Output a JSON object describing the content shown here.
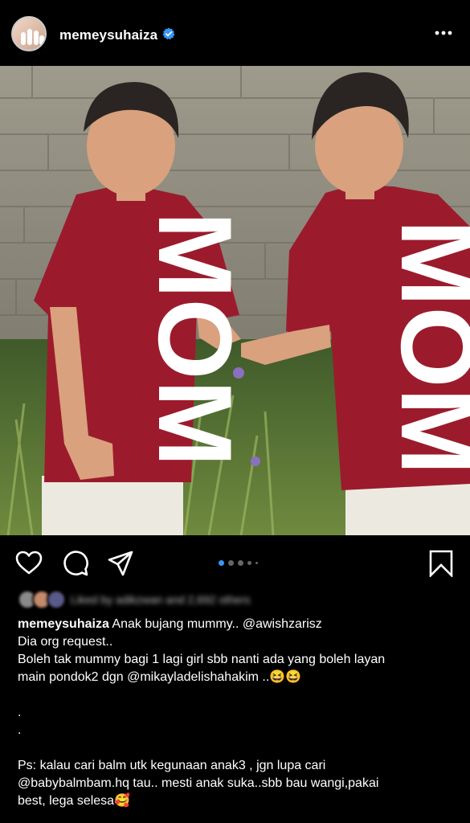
{
  "post": {
    "username": "memeysuhaiza",
    "likes_text": "Liked by adikzwan and 2,692 others",
    "carousel": {
      "count": 5,
      "active_index": 0
    },
    "caption": {
      "line1_text": "Anak bujang mummy..",
      "line1_mention": "@awishzarisz",
      "line2": "Dia org request..",
      "line3": "Boleh tak mummy bagi  1 lagi girl sbb nanti ada yang boleh layan",
      "line4_text": "main pondok2 dgn",
      "line4_mention": "@mikayladelishahakim",
      "line4_tail": "..😆😆",
      "dot1": ".",
      "dot2": ".",
      "line5": "Ps: kalau cari balm utk kegunaan anak3 , jgn lupa cari",
      "line6": "@babybalmbam.hq tau.. mesti anak suka..sbb bau wangi,pakai",
      "line7": "best, lega selesa🥰"
    },
    "photo": {
      "shirt_text": "MOM"
    }
  },
  "icons": {
    "more": "more-horizontal-icon",
    "like": "heart-icon",
    "comment": "comment-icon",
    "share": "send-icon",
    "save": "bookmark-icon",
    "verified": "verified-badge-icon"
  },
  "colors": {
    "background": "#000000",
    "accent": "#3897f0",
    "shirt": "#9b1b2c"
  }
}
